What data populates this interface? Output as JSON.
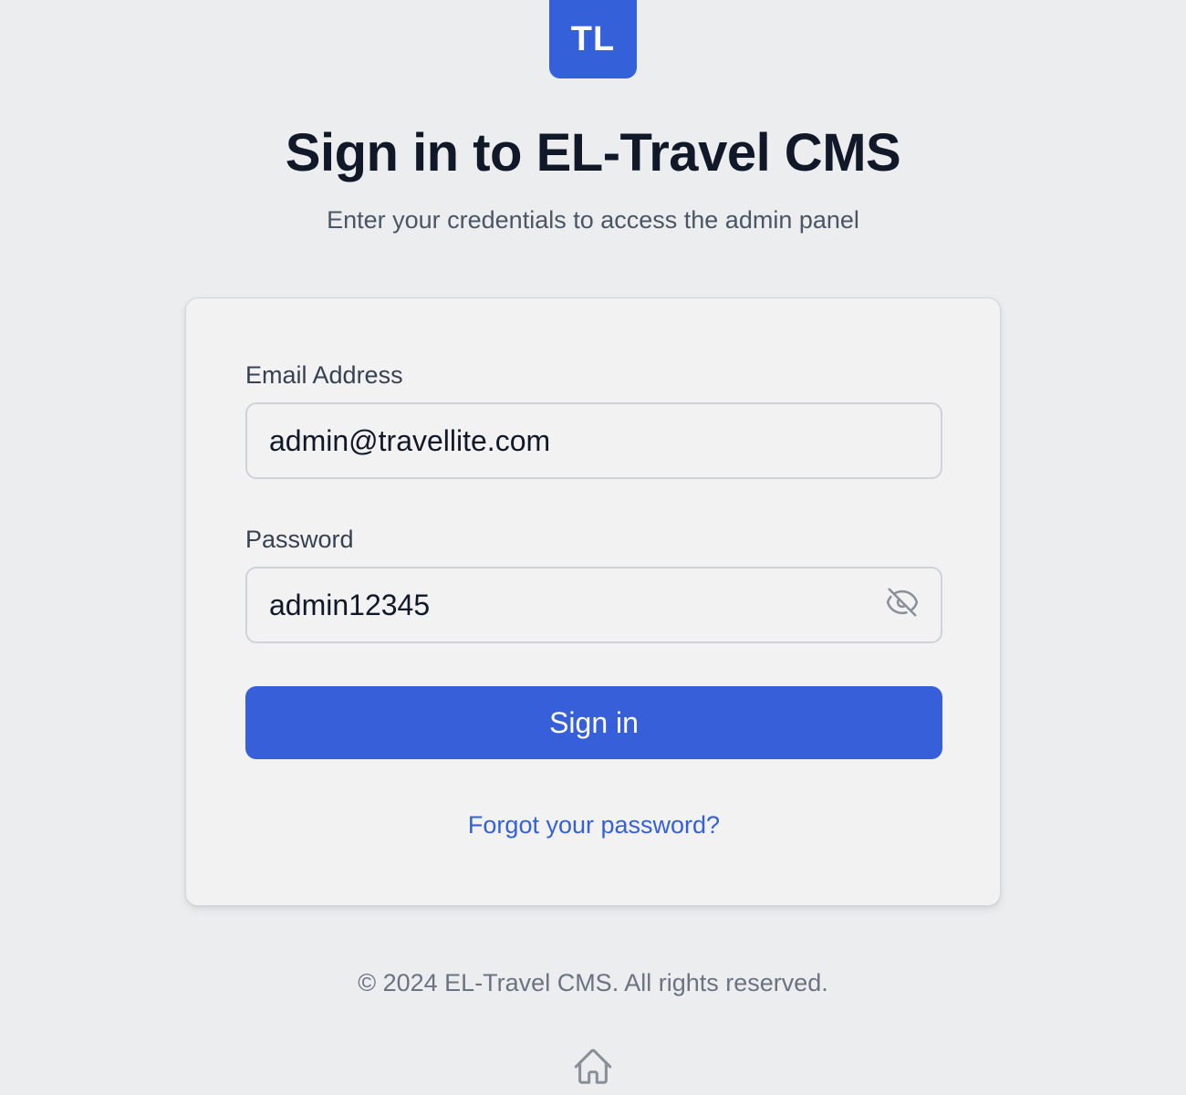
{
  "brand": {
    "logo_text": "TL",
    "accent_color": "#3460DA"
  },
  "header": {
    "title": "Sign in to EL-Travel CMS",
    "subtitle": "Enter your credentials to access the admin panel"
  },
  "form": {
    "email": {
      "label": "Email Address",
      "value": "admin@travellite.com"
    },
    "password": {
      "label": "Password",
      "value": "admin12345",
      "toggle_icon": "eye-off-icon"
    },
    "submit_label": "Sign in",
    "forgot_label": "Forgot your password?"
  },
  "footer": {
    "copyright": "© 2024 EL-Travel CMS. All rights reserved.",
    "home_icon": "home-icon"
  }
}
